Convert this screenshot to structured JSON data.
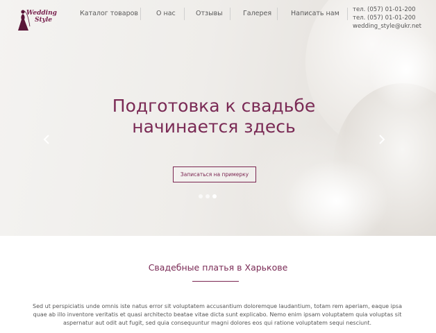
{
  "brand": {
    "name_line1": "Wedding",
    "name_line2": "Style",
    "accent_color": "#7a2550"
  },
  "nav": {
    "items": [
      {
        "label": "Каталог товаров"
      },
      {
        "label": "О нас"
      },
      {
        "label": "Отзывы"
      },
      {
        "label": "Галерея"
      },
      {
        "label": "Написать нам"
      }
    ]
  },
  "contacts": {
    "phone1": "тел. (057) 01-01-200",
    "phone2": "тел. (057) 01-01-200",
    "email": "wedding_style@ukr.net"
  },
  "hero": {
    "headline_line1": "Подготовка к свадьбе",
    "headline_line2": "начинается здесь",
    "cta_label": "Записаться на примерку",
    "prev_icon": "chevron-left-icon",
    "next_icon": "chevron-right-icon",
    "slide_count": 3,
    "active_slide": 3
  },
  "section": {
    "title": "Свадебные платья в Харькове",
    "text": "Sed ut perspiciatis unde omnis iste natus error sit voluptatem accusantium doloremque laudantium, totam rem aperiam, eaque ipsa quae ab illo inventore veritatis et quasi architecto beatae vitae dicta sunt explicabo. Nemo enim ipsam voluptatem quia voluptas sit aspernatur aut odit aut fugit, sed quia consequuntur magni dolores eos qui ratione voluptatem sequi nesciunt."
  }
}
